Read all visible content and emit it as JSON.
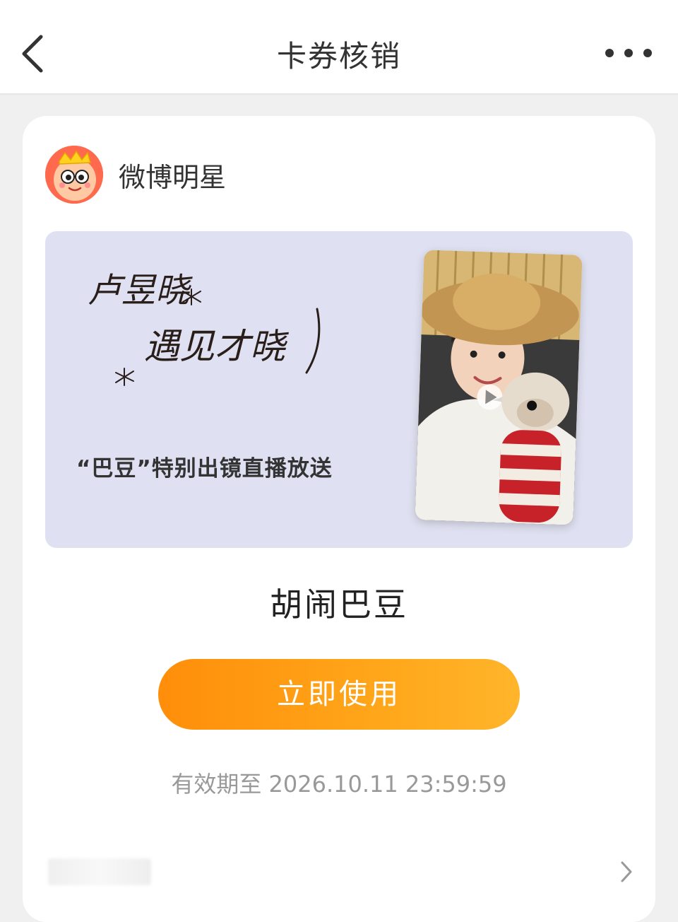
{
  "header": {
    "title": "卡券核销"
  },
  "card": {
    "brand_name": "微博明星",
    "banner": {
      "subtitle": "“巴豆”特别出镜直播放送",
      "handwriting_text": [
        "卢昱晓",
        "遇见才晓"
      ]
    },
    "coupon_name": "胡闹巴豆",
    "use_button_label": "立即使用",
    "expiry_text": "有效期至 2026.10.11 23:59:59"
  },
  "icons": {
    "back": "chevron-left-icon",
    "more": "more-dots-icon",
    "row_arrow": "chevron-right-icon"
  },
  "colors": {
    "accent_orange": "#ff9a10",
    "banner_bg": "#dfe1f2",
    "page_bg": "#f0f0f0"
  }
}
